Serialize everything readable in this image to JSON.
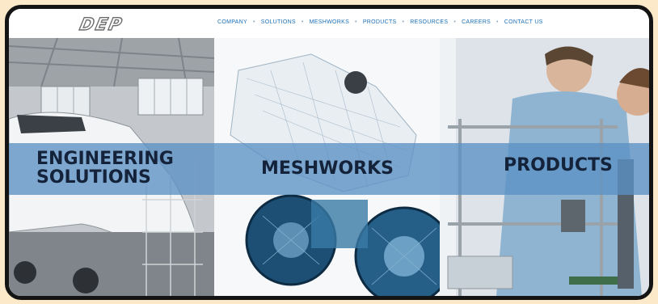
{
  "header": {
    "logo_text": "DEP",
    "nav": [
      "COMPANY",
      "SOLUTIONS",
      "MESHWORKS",
      "PRODUCTS",
      "RESOURCES",
      "CAREERS",
      "CONTACT US"
    ]
  },
  "panels": [
    {
      "title_line1": "ENGINEERING",
      "title_line2": "SOLUTIONS",
      "image": "aircraft-hangar"
    },
    {
      "title": "MESHWORKS",
      "image": "motorcycle-mesh"
    },
    {
      "title": "PRODUCTS",
      "image": "engineers-lab"
    }
  ],
  "colors": {
    "page_background": "#fbe9c9",
    "frame": "#141414",
    "nav_link": "#1c6fb5",
    "band": "#5b91c4",
    "title_text": "#14233a"
  }
}
